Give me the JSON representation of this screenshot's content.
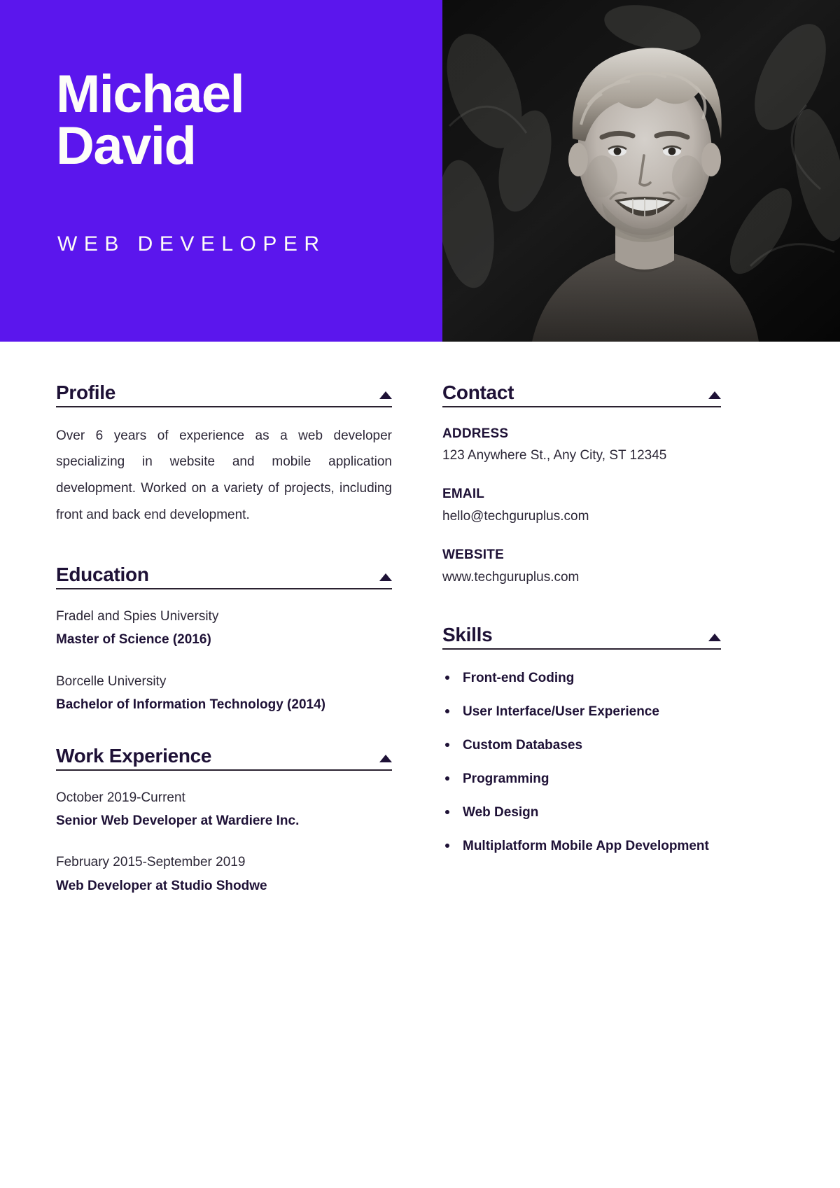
{
  "theme": {
    "accent_purple": "#5B16ED",
    "heading_navy": "#1E1136",
    "body_text": "#2B2636",
    "header_text": "#FDFDF8"
  },
  "header": {
    "name_first": "Michael",
    "name_last": "David",
    "role": "WEB DEVELOPER",
    "photo_alt": "portrait-photo"
  },
  "left_column": {
    "profile": {
      "title": "Profile",
      "collapse_icon": "caret-up-icon",
      "paragraph": "Over 6 years of experience as a web developer specializing in website and mobile application development. Worked on a variety of projects, including front and back end development."
    },
    "education": {
      "title": "Education",
      "collapse_icon": "caret-up-icon",
      "entries": [
        {
          "school": "Fradel and Spies University",
          "degree": "Master of Science (2016)"
        },
        {
          "school": "Borcelle University",
          "degree": "Bachelor of Information Technology (2014)"
        }
      ]
    },
    "work_experience": {
      "title": "Work Experience",
      "collapse_icon": "caret-up-icon",
      "entries": [
        {
          "period": "October 2019-Current",
          "position": "Senior Web Developer at Wardiere Inc."
        },
        {
          "period": "February 2015-September 2019",
          "position": "Web Developer at Studio Shodwe"
        }
      ]
    }
  },
  "right_column": {
    "contact": {
      "title": "Contact",
      "collapse_icon": "caret-up-icon",
      "items": [
        {
          "label": "ADDRESS",
          "value": "123 Anywhere St., Any City, ST 12345"
        },
        {
          "label": "EMAIL",
          "value": "hello@techguruplus.com"
        },
        {
          "label": "WEBSITE",
          "value": "www.techguruplus.com"
        }
      ]
    },
    "skills": {
      "title": "Skills",
      "collapse_icon": "caret-up-icon",
      "items": [
        "Front-end Coding",
        "User Interface/User Experience",
        "Custom Databases",
        "Programming",
        "Web Design",
        "Multiplatform Mobile App Development"
      ]
    }
  }
}
